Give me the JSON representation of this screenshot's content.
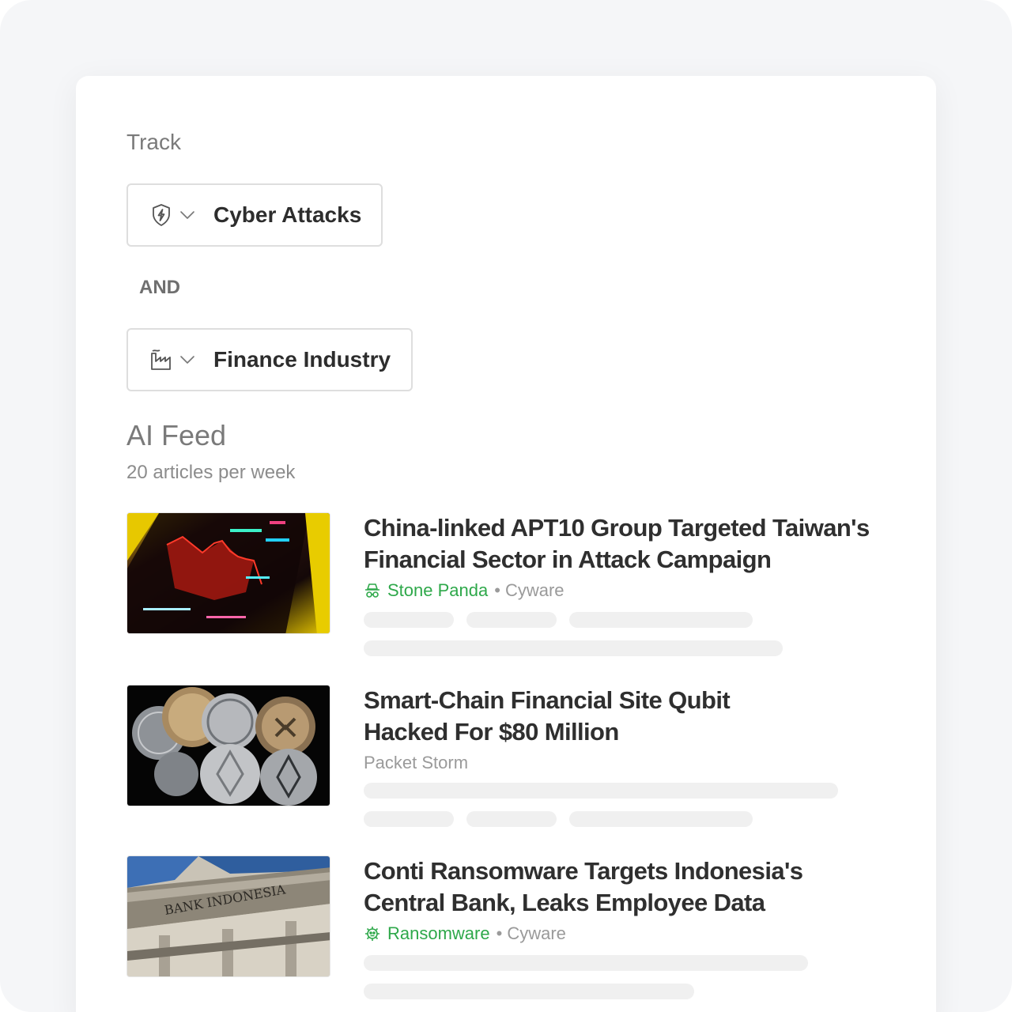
{
  "track": {
    "label": "Track",
    "filters": [
      {
        "label": "Cyber Attacks",
        "icon": "shield-bolt-icon"
      },
      {
        "label": "Finance Industry",
        "icon": "factory-icon"
      }
    ],
    "operator": "AND"
  },
  "feed": {
    "title": "AI Feed",
    "subtitle": "20 articles per week",
    "articles": [
      {
        "title_line1": "China-linked APT10 Group Targeted Taiwan's",
        "title_line2": "Financial Sector in Attack Campaign",
        "tag": "Stone Panda",
        "tag_icon": "spy-icon",
        "separator": "•",
        "source": "Cyware",
        "image": "stock-chart-image"
      },
      {
        "title_line1": "Smart-Chain Financial Site Qubit",
        "title_line2": "Hacked For $80 Million",
        "source": "Packet Storm",
        "image": "crypto-coins-image"
      },
      {
        "title_line1": "Conti Ransomware Targets Indonesia's",
        "title_line2": "Central Bank, Leaks Employee Data",
        "tag": "Ransomware",
        "tag_icon": "ransomware-bug-icon",
        "separator": "•",
        "source": "Cyware",
        "image": "bank-building-image"
      }
    ]
  },
  "colors": {
    "accent_green": "#2ea84a",
    "page_bg": "#f5f6f8",
    "card_bg": "#ffffff",
    "placeholder": "#f0f0f0"
  }
}
